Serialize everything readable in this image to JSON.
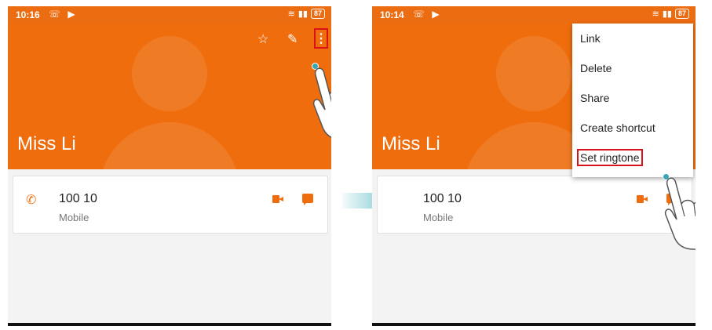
{
  "colors": {
    "accent": "#ef6d0d",
    "highlight": "#d8121a",
    "arrow": "#2aa7b3"
  },
  "left_screen": {
    "status": {
      "time": "10:16",
      "battery": "87"
    },
    "contact": {
      "name": "Miss Li"
    },
    "actions": {
      "star_icon": "star-icon",
      "edit_icon": "pencil-icon",
      "more_icon": "more-vert-icon",
      "more_glyph": "⋮"
    },
    "phone_entry": {
      "number": "100 10",
      "type": "Mobile"
    }
  },
  "right_screen": {
    "status": {
      "time": "10:14",
      "battery": "87"
    },
    "contact": {
      "name": "Miss Li"
    },
    "menu": {
      "items": [
        "Link",
        "Delete",
        "Share",
        "Create shortcut",
        "Set ringtone"
      ],
      "highlighted_item": "Set ringtone"
    },
    "phone_entry": {
      "number": "100 10",
      "type": "Mobile"
    }
  }
}
